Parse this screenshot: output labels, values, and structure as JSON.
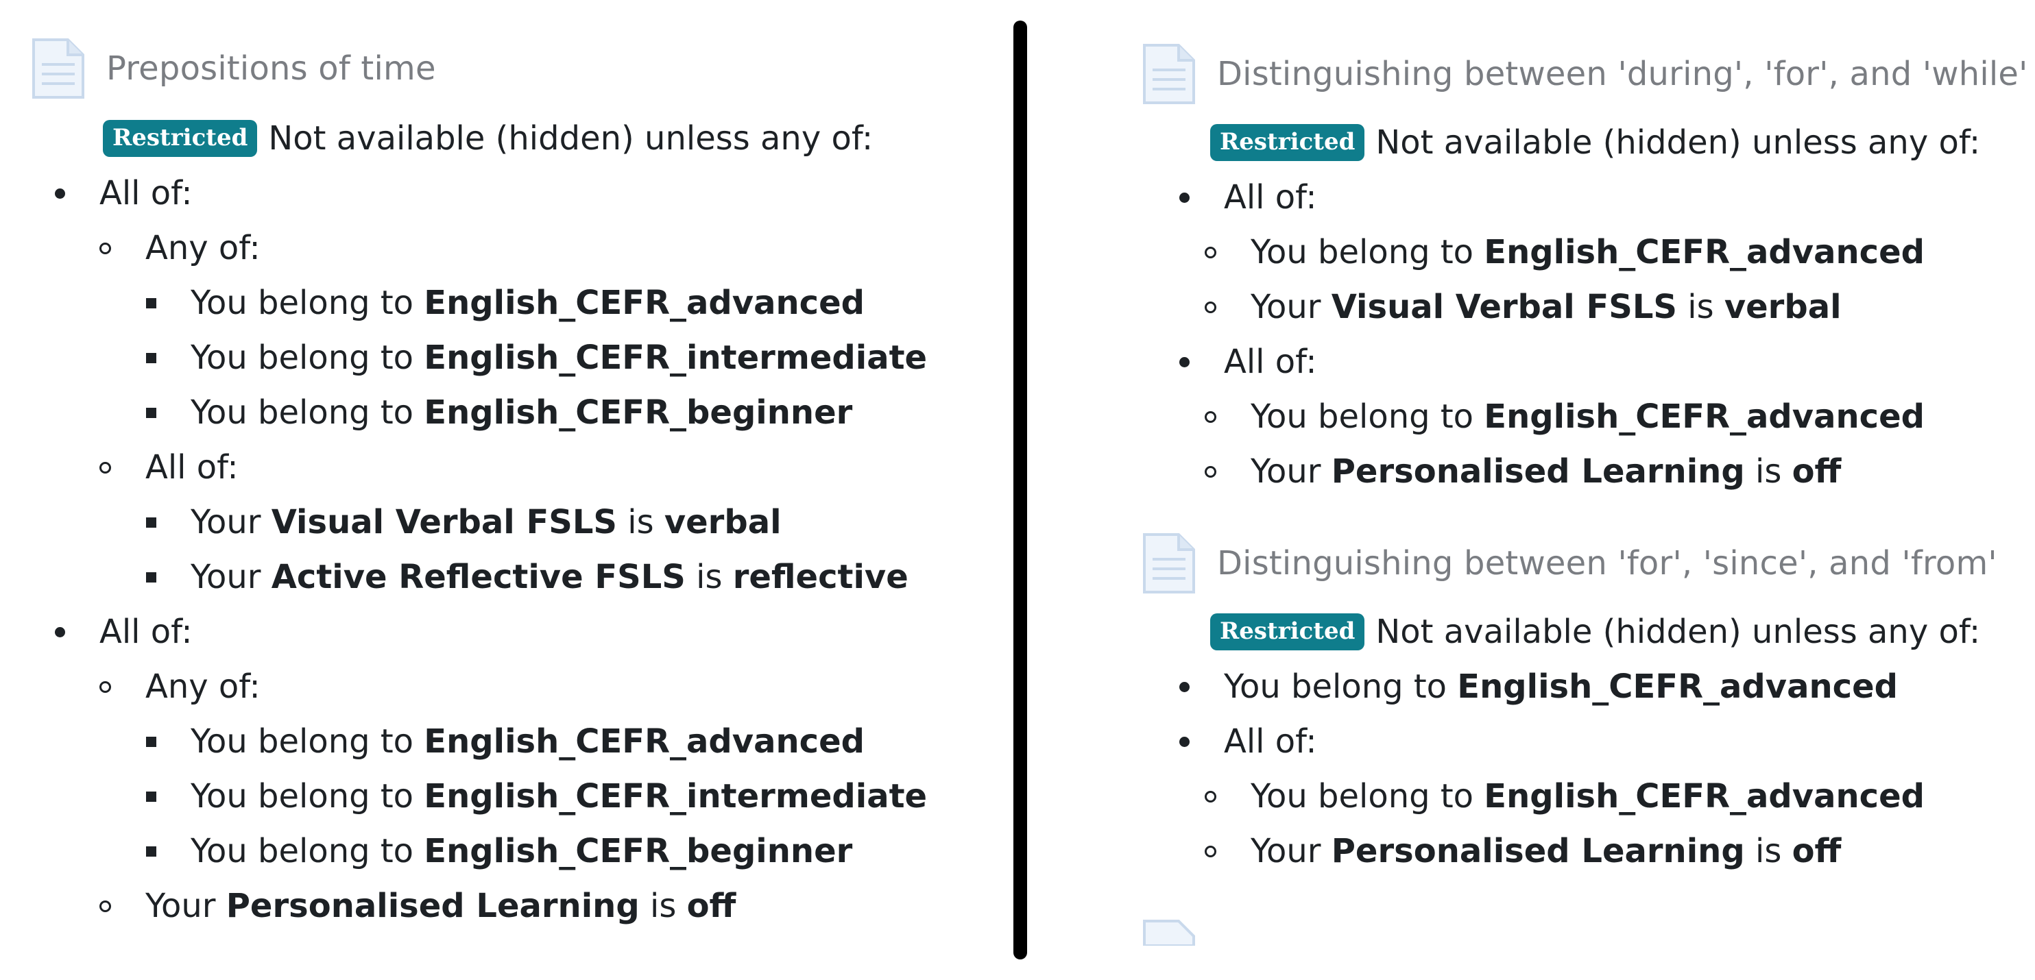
{
  "badge_label": "Restricted",
  "restriction_intro": "Not available (hidden) unless any of:",
  "left": {
    "title": "Prepositions of time",
    "rules": [
      {
        "level": 1,
        "bullet": "disc",
        "pre": "All of:",
        "b1": "",
        "mid": "",
        "b2": ""
      },
      {
        "level": 2,
        "bullet": "circle",
        "pre": "Any of:",
        "b1": "",
        "mid": "",
        "b2": ""
      },
      {
        "level": 3,
        "bullet": "square",
        "pre": "You belong to ",
        "b1": "English_CEFR_advanced",
        "mid": "",
        "b2": ""
      },
      {
        "level": 3,
        "bullet": "square",
        "pre": "You belong to ",
        "b1": "English_CEFR_intermediate",
        "mid": "",
        "b2": ""
      },
      {
        "level": 3,
        "bullet": "square",
        "pre": "You belong to ",
        "b1": "English_CEFR_beginner",
        "mid": "",
        "b2": ""
      },
      {
        "level": 2,
        "bullet": "circle",
        "pre": "All of:",
        "b1": "",
        "mid": "",
        "b2": ""
      },
      {
        "level": 3,
        "bullet": "square",
        "pre": "Your ",
        "b1": "Visual Verbal FSLS",
        "mid": " is ",
        "b2": "verbal"
      },
      {
        "level": 3,
        "bullet": "square",
        "pre": "Your ",
        "b1": "Active Reflective FSLS",
        "mid": " is ",
        "b2": "reflective"
      },
      {
        "level": 1,
        "bullet": "disc",
        "pre": "All of:",
        "b1": "",
        "mid": "",
        "b2": ""
      },
      {
        "level": 2,
        "bullet": "circle",
        "pre": "Any of:",
        "b1": "",
        "mid": "",
        "b2": ""
      },
      {
        "level": 3,
        "bullet": "square",
        "pre": "You belong to ",
        "b1": "English_CEFR_advanced",
        "mid": "",
        "b2": ""
      },
      {
        "level": 3,
        "bullet": "square",
        "pre": "You belong to ",
        "b1": "English_CEFR_intermediate",
        "mid": "",
        "b2": ""
      },
      {
        "level": 3,
        "bullet": "square",
        "pre": "You belong to ",
        "b1": "English_CEFR_beginner",
        "mid": "",
        "b2": ""
      },
      {
        "level": 2,
        "bullet": "circle",
        "pre": "Your ",
        "b1": "Personalised Learning",
        "mid": " is ",
        "b2": "off"
      }
    ]
  },
  "right_top": {
    "title": "Distinguishing between 'during', 'for', and 'while'",
    "rules": [
      {
        "level": 1,
        "bullet": "disc",
        "pre": "All of:",
        "b1": "",
        "mid": "",
        "b2": ""
      },
      {
        "level": 2,
        "bullet": "circle",
        "pre": "You belong to ",
        "b1": "English_CEFR_advanced",
        "mid": "",
        "b2": ""
      },
      {
        "level": 2,
        "bullet": "circle",
        "pre": "Your ",
        "b1": "Visual Verbal FSLS",
        "mid": " is ",
        "b2": "verbal"
      },
      {
        "level": 1,
        "bullet": "disc",
        "pre": "All of:",
        "b1": "",
        "mid": "",
        "b2": ""
      },
      {
        "level": 2,
        "bullet": "circle",
        "pre": "You belong to ",
        "b1": "English_CEFR_advanced",
        "mid": "",
        "b2": ""
      },
      {
        "level": 2,
        "bullet": "circle",
        "pre": "Your ",
        "b1": "Personalised Learning",
        "mid": " is ",
        "b2": "off"
      }
    ]
  },
  "right_bottom": {
    "title": "Distinguishing between 'for', 'since', and 'from'",
    "rules": [
      {
        "level": 1,
        "bullet": "disc",
        "pre": "You belong to ",
        "b1": "English_CEFR_advanced",
        "mid": "",
        "b2": ""
      },
      {
        "level": 1,
        "bullet": "disc",
        "pre": "All of:",
        "b1": "",
        "mid": "",
        "b2": ""
      },
      {
        "level": 2,
        "bullet": "circle",
        "pre": "You belong to ",
        "b1": "English_CEFR_advanced",
        "mid": "",
        "b2": ""
      },
      {
        "level": 2,
        "bullet": "circle",
        "pre": "Your ",
        "b1": "Personalised Learning",
        "mid": " is ",
        "b2": "off"
      }
    ]
  },
  "colors": {
    "badge": "#0f7d8c",
    "title": "#7a7d82",
    "text": "#1d2125"
  },
  "icons": [
    "page-icon"
  ]
}
